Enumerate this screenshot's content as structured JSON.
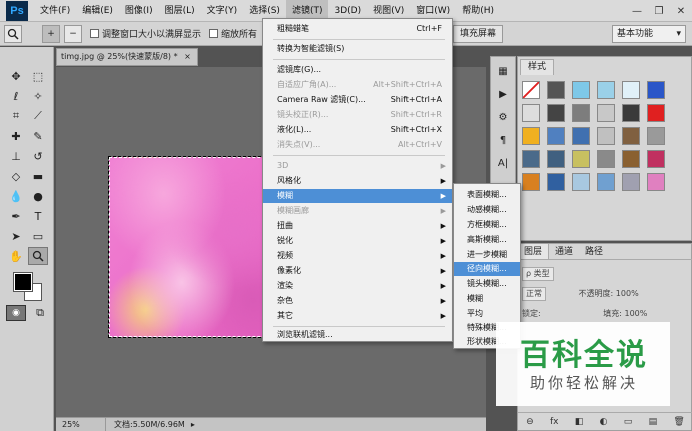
{
  "app": {
    "logo": "Ps"
  },
  "menubar": {
    "items": [
      "文件(F)",
      "编辑(E)",
      "图像(I)",
      "图层(L)",
      "文字(Y)",
      "选择(S)",
      "滤镜(T)",
      "3D(D)",
      "视图(V)",
      "窗口(W)",
      "帮助(H)"
    ],
    "active_index": 6
  },
  "window_controls": {
    "minimize": "—",
    "restore": "❐",
    "close": "✕"
  },
  "options_bar": {
    "zoom_in": "+",
    "zoom_out": "−",
    "resize_windows_label": "调整窗口大小以满屏显示",
    "zoom_all_label": "缩放所有",
    "fill_screen_label": "填充屏幕",
    "workspace": "基本功能"
  },
  "document": {
    "tab_title": "timg.jpg @ 25%(快速蒙版/8) *",
    "tab_close": "×",
    "zoom": "25%",
    "doc_info": "文档:5.50M/6.96M",
    "status_arrow": "▸"
  },
  "filter_menu": {
    "items": [
      {
        "label": "粗糙蜡笔",
        "shortcut": "Ctrl+F",
        "disabled": false
      },
      {
        "label": "转换为智能滤镜(S)",
        "shortcut": "",
        "disabled": false
      },
      {
        "label": "滤镜库(G)...",
        "shortcut": "",
        "disabled": false
      },
      {
        "label": "自适应广角(A)...",
        "shortcut": "Alt+Shift+Ctrl+A",
        "disabled": true
      },
      {
        "label": "Camera Raw 滤镜(C)...",
        "shortcut": "Shift+Ctrl+A",
        "disabled": false
      },
      {
        "label": "镜头校正(R)...",
        "shortcut": "Shift+Ctrl+R",
        "disabled": true
      },
      {
        "label": "液化(L)...",
        "shortcut": "Shift+Ctrl+X",
        "disabled": false
      },
      {
        "label": "消失点(V)...",
        "shortcut": "Alt+Ctrl+V",
        "disabled": true
      },
      {
        "label": "3D",
        "shortcut": "",
        "disabled": true,
        "submenu": true
      },
      {
        "label": "风格化",
        "shortcut": "",
        "disabled": false,
        "submenu": true
      },
      {
        "label": "模糊",
        "shortcut": "",
        "disabled": false,
        "submenu": true,
        "highlighted": true
      },
      {
        "label": "模糊画廊",
        "shortcut": "",
        "disabled": true,
        "submenu": true
      },
      {
        "label": "扭曲",
        "shortcut": "",
        "disabled": false,
        "submenu": true
      },
      {
        "label": "锐化",
        "shortcut": "",
        "disabled": false,
        "submenu": true
      },
      {
        "label": "视频",
        "shortcut": "",
        "disabled": false,
        "submenu": true
      },
      {
        "label": "像素化",
        "shortcut": "",
        "disabled": false,
        "submenu": true
      },
      {
        "label": "渲染",
        "shortcut": "",
        "disabled": false,
        "submenu": true
      },
      {
        "label": "杂色",
        "shortcut": "",
        "disabled": false,
        "submenu": true
      },
      {
        "label": "其它",
        "shortcut": "",
        "disabled": false,
        "submenu": true
      },
      {
        "label": "浏览联机滤镜...",
        "shortcut": "",
        "disabled": false
      }
    ],
    "submenu_arrow": "▶"
  },
  "blur_submenu": {
    "items": [
      "表面模糊...",
      "动感模糊...",
      "方框模糊...",
      "高斯模糊...",
      "进一步模糊",
      "径向模糊...",
      "镜头模糊...",
      "模糊",
      "平均",
      "特殊模糊...",
      "形状模糊..."
    ],
    "highlighted_index": 5
  },
  "right_panels": {
    "styles_tab": "样式",
    "layers_tabs": [
      "图层",
      "通道",
      "路径"
    ],
    "kind_filter": "ρ 类型",
    "blend_mode": "正常",
    "opacity_label": "不透明度:",
    "opacity_value": "100%",
    "lock_label": "锁定:",
    "fill_label": "填充:",
    "fill_value": "100%",
    "footer_icons": [
      "⊖",
      "fx",
      "◧",
      "◐",
      "▭",
      "▤",
      "🗑"
    ]
  },
  "watermark": {
    "title": "百科全说",
    "subtitle": "助你轻松解决"
  },
  "colors": {
    "menu_highlight": "#4d8fd6",
    "watermark_green": "#2a9b47",
    "canvas_bg": "#6a6a6a"
  },
  "styles_swatches": [
    "#ffffff",
    "#555555",
    "#7ec8e8",
    "#9ad0e8",
    "#e0f0f8",
    "#2a56c8",
    "#dddddd",
    "#444444",
    "#7d7d7d",
    "#c8c8c8",
    "#3a3a3a",
    "#e02020",
    "#f0b020",
    "#5080c0",
    "#4070b0",
    "#c0c0c0",
    "#806040",
    "#9a9a9a",
    "#4a6a8a",
    "#406080",
    "#c8c060",
    "#8a8a8a",
    "#8a6030",
    "#c03060",
    "#d88020",
    "#3060a0",
    "#a8c8e0",
    "#70a0d0",
    "#a0a0b0",
    "#e080c0"
  ]
}
